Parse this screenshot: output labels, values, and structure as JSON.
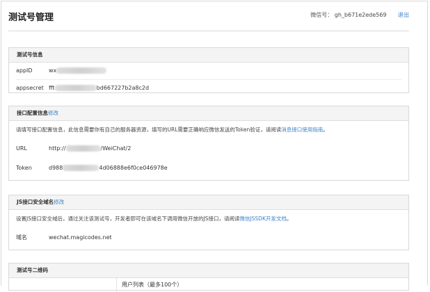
{
  "header": {
    "title": "测试号管理",
    "account_label": "微信号：",
    "account_id": "gh_b671e2ede569",
    "logout_label": "退出"
  },
  "account_info": {
    "title": "测试号信息",
    "appid_label": "appID",
    "appid_prefix": "wx",
    "appsecret_label": "appsecret",
    "appsecret_prefix": "fft",
    "appsecret_suffix": "bd667227b2a8c2d"
  },
  "interface_config": {
    "title": "接口配置信息",
    "edit_label": "修改",
    "description": "请填写接口配置信息，此信息需要你有自己的服务器资源，填写的URL需要正确响应微信发送的Token验证，请阅读",
    "guide_link": "消息接口使用指南",
    "description_end": "。",
    "url_label": "URL",
    "url_prefix": "http://",
    "url_suffix": "/WeiChat/2",
    "token_label": "Token",
    "token_prefix": "d988",
    "token_suffix": "4d06888e6f0ce046978e"
  },
  "js_domain": {
    "title": "JS接口安全域名",
    "edit_label": "修改",
    "description": "设置JS接口安全域后，通过关注该测试号，开发者即可在该域名下调用微信开放的JS接口，请阅读",
    "doc_link": "微信JSSDK开发文档",
    "description_end": "。",
    "domain_label": "域名",
    "domain_value": "wechat.magicodes.net"
  },
  "qrcode": {
    "title": "测试号二维码",
    "user_list_partial": "用户列表（最多100个）"
  }
}
